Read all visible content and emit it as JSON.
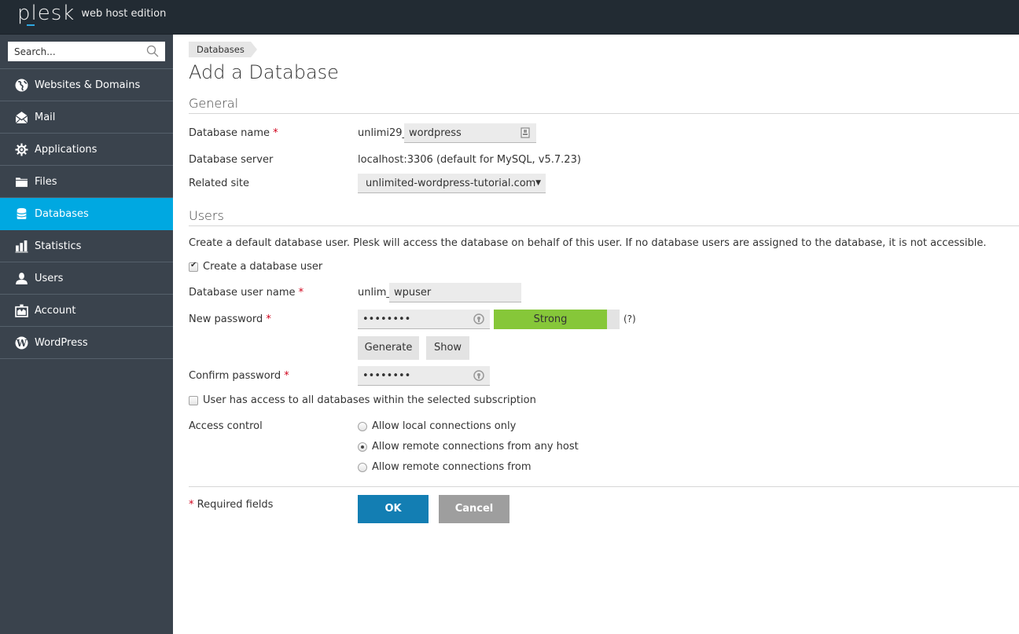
{
  "header": {
    "logo": "plesk",
    "edition": "web host edition"
  },
  "sidebar": {
    "search_placeholder": "Search...",
    "items": [
      {
        "label": "Websites & Domains",
        "icon": "globe-icon",
        "active": false
      },
      {
        "label": "Mail",
        "icon": "mail-icon",
        "active": false
      },
      {
        "label": "Applications",
        "icon": "gear-icon",
        "active": false
      },
      {
        "label": "Files",
        "icon": "folder-icon",
        "active": false
      },
      {
        "label": "Databases",
        "icon": "database-icon",
        "active": true
      },
      {
        "label": "Statistics",
        "icon": "bar-chart-icon",
        "active": false
      },
      {
        "label": "Users",
        "icon": "user-icon",
        "active": false
      },
      {
        "label": "Account",
        "icon": "account-icon",
        "active": false
      },
      {
        "label": "WordPress",
        "icon": "wordpress-icon",
        "active": false
      }
    ]
  },
  "breadcrumb": [
    "Databases"
  ],
  "page_title": "Add a Database",
  "general": {
    "title": "General",
    "db_name_label": "Database name",
    "db_name_prefix": "unlimi29_",
    "db_name_value": "wordpress",
    "db_server_label": "Database server",
    "db_server_value": "localhost:3306 (default for MySQL, v5.7.23)",
    "related_site_label": "Related site",
    "related_site_value": "unlimited-wordpress-tutorial.com"
  },
  "users": {
    "title": "Users",
    "description": "Create a default database user. Plesk will access the database on behalf of this user. If no database users are assigned to the database, it is not accessible.",
    "create_user_label": "Create a database user",
    "create_user_checked": true,
    "user_name_label": "Database user name",
    "user_name_prefix": "unlim_",
    "user_name_value": "wpuser",
    "new_password_label": "New password",
    "password_mask": "••••••••",
    "strength_label": "Strong",
    "strength_fraction": 0.9,
    "help_label": "(?)",
    "generate_label": "Generate",
    "show_label": "Show",
    "confirm_password_label": "Confirm password",
    "all_access_label": "User has access to all databases within the selected subscription",
    "all_access_checked": false,
    "access_control_label": "Access control",
    "access_options": [
      {
        "label": "Allow local connections only",
        "checked": false
      },
      {
        "label": "Allow remote connections from any host",
        "checked": true
      },
      {
        "label": "Allow remote connections from",
        "checked": false
      }
    ]
  },
  "footer": {
    "required_star": "*",
    "required_label": "Required fields",
    "ok_label": "OK",
    "cancel_label": "Cancel"
  },
  "required_star": "*",
  "colors": {
    "topbar": "#222b33",
    "sidebar": "#3a434d",
    "active": "#00a8e1",
    "ok": "#137eb3",
    "strength": "#86c739"
  }
}
